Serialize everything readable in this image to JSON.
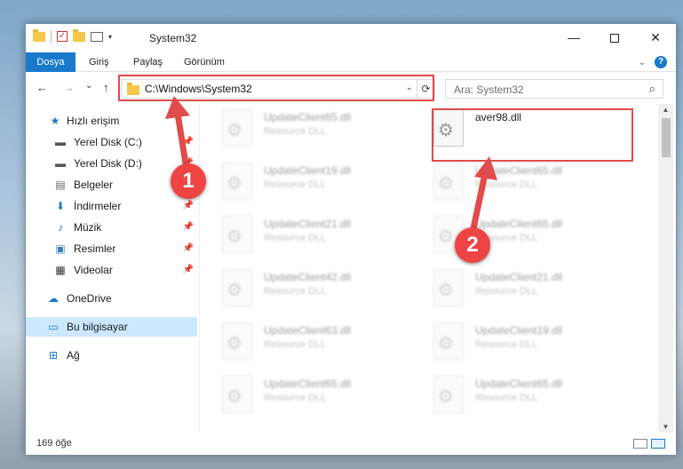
{
  "window": {
    "title": "System32",
    "minimize": "—",
    "close": "✕"
  },
  "ribbon": {
    "file": "Dosya",
    "tabs": [
      "Giriş",
      "Paylaş",
      "Görünüm"
    ],
    "help": "?"
  },
  "navbar": {
    "back": "←",
    "forward": "→",
    "recent": "⌄",
    "up": "↑",
    "path": "C:\\Windows\\System32",
    "refresh": "⟳",
    "search_placeholder": "Ara: System32"
  },
  "sidebar": {
    "items": [
      {
        "label": "Hızlı erişim",
        "icon": "star-icon",
        "pinned": false
      },
      {
        "label": "Yerel Disk (C:)",
        "icon": "drive-icon",
        "pinned": true
      },
      {
        "label": "Yerel Disk (D:)",
        "icon": "drive-icon",
        "pinned": true
      },
      {
        "label": "Belgeler",
        "icon": "document-icon",
        "pinned": true
      },
      {
        "label": "İndirmeler",
        "icon": "download-icon",
        "pinned": true
      },
      {
        "label": "Müzik",
        "icon": "music-icon",
        "pinned": true
      },
      {
        "label": "Resimler",
        "icon": "pictures-icon",
        "pinned": true
      },
      {
        "label": "Videolar",
        "icon": "video-icon",
        "pinned": true
      },
      {
        "label": "OneDrive",
        "icon": "cloud-icon",
        "pinned": false
      },
      {
        "label": "Bu bilgisayar",
        "icon": "computer-icon",
        "pinned": false
      },
      {
        "label": "Ağ",
        "icon": "network-icon",
        "pinned": false
      }
    ]
  },
  "files": {
    "left_column": [
      {
        "name": "UpdateClient65.dll",
        "type": "Resource DLL"
      },
      {
        "name": "UpdateClient19.dll",
        "type": "Resource DLL"
      },
      {
        "name": "UpdateClient21.dll",
        "type": "Resource DLL"
      },
      {
        "name": "UpdateClient42.dll",
        "type": "Resource DLL"
      },
      {
        "name": "UpdateClient63.dll",
        "type": "Resource DLL"
      },
      {
        "name": "UpdateClient65.dll",
        "type": "Resource DLL"
      }
    ],
    "right_column": [
      {
        "name": "aver98.dll",
        "type": ""
      },
      {
        "name": "UpdateClient65.dll",
        "type": "Resource DLL"
      },
      {
        "name": "UpdateClient65.dll",
        "type": "Resource DLL"
      },
      {
        "name": "UpdateClient21.dll",
        "type": "Resource DLL"
      },
      {
        "name": "UpdateClient19.dll",
        "type": "Resource DLL"
      },
      {
        "name": "UpdateClient65.dll",
        "type": "Resource DLL"
      }
    ]
  },
  "status": {
    "count": "169 öğe"
  },
  "annotations": {
    "badge1": "1",
    "badge2": "2",
    "color": "#e04b4b"
  }
}
